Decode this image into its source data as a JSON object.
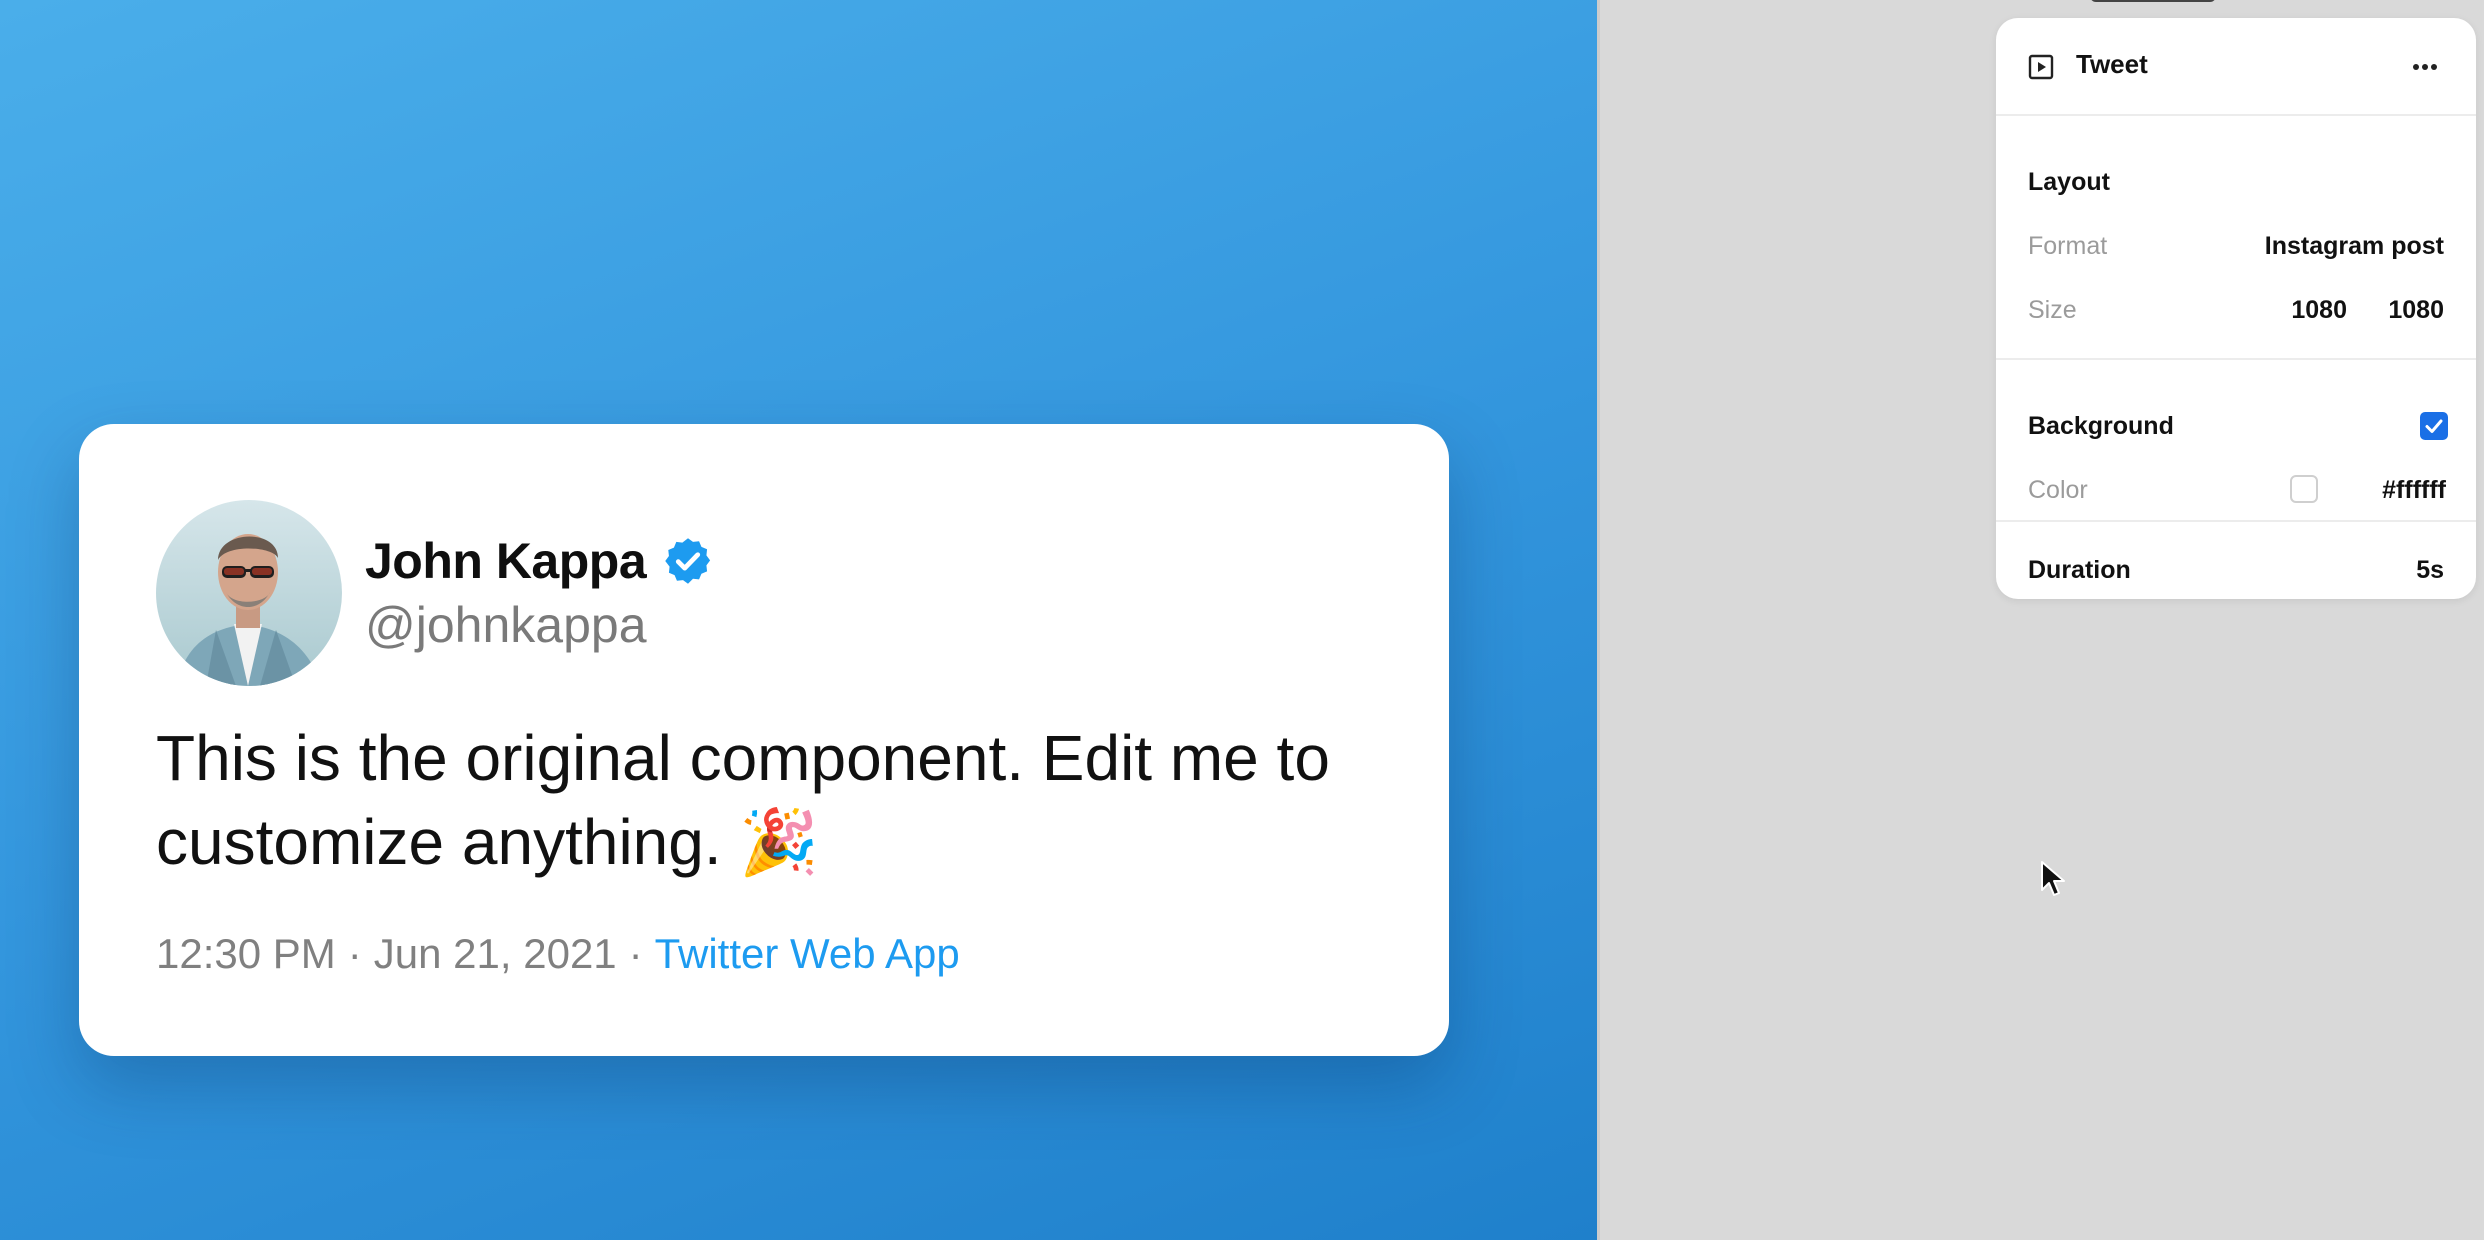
{
  "tweet": {
    "name": "John Kappa",
    "handle": "@johnkappa",
    "text": "This is the original component. Edit me to customize anything. 🎉",
    "time": "12:30 PM",
    "date": "Jun 21, 2021",
    "separator": "·",
    "source": "Twitter Web App",
    "verified": true,
    "icons": {
      "avatar": "profile-photo",
      "verified": "verified-badge-icon"
    }
  },
  "canvas": {
    "background_from": "#4aaeea",
    "background_to": "#1f80cb"
  },
  "panel": {
    "title": "Tweet",
    "title_icon": "play-square-icon",
    "menu_icon": "more-horizontal-icon",
    "layout": {
      "heading": "Layout",
      "format_label": "Format",
      "format_value": "Instagram post",
      "size_label": "Size",
      "size_width": "1080",
      "size_height": "1080"
    },
    "background": {
      "heading": "Background",
      "enabled": true,
      "color_label": "Color",
      "color_value": "#ffffff"
    },
    "duration": {
      "label": "Duration",
      "value": "5s"
    }
  },
  "colors": {
    "accent": "#1d9bf0",
    "checkbox": "#1a6fe6",
    "panel_bg": "#ffffff",
    "workspace_bg": "#d9d9d9"
  }
}
